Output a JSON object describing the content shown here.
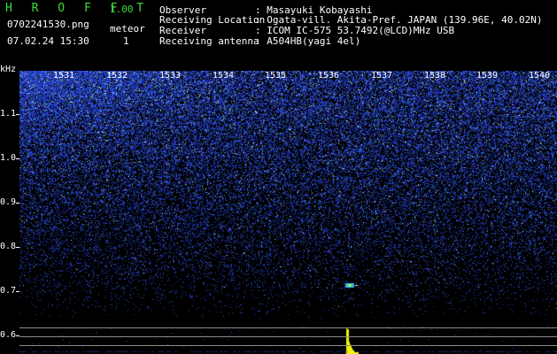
{
  "app": {
    "logo": "H R O F F T",
    "version": "1.00"
  },
  "file": {
    "name": "0702241530.png",
    "datetime": "07.02.24 15:30"
  },
  "meteor": {
    "label": "meteor",
    "count": "1"
  },
  "info": [
    {
      "label": "Observer",
      "value": ": Masayuki Kobayashi"
    },
    {
      "label": "Receiving Location",
      "value": ": Ogata-vill. Akita-Pref. JAPAN (139.96E, 40.02N)"
    },
    {
      "label": "Receiver",
      "value": ": ICOM IC-575 53.7492(@LCD)MHz USB"
    },
    {
      "label": "Receiving antenna",
      "value": ": A504HB(yagi 4el)"
    }
  ],
  "axis": {
    "y_unit": "kHz",
    "y_ticks": [
      "1.1",
      "1.0",
      "0.9",
      "0.8",
      "0.7",
      "0.6"
    ],
    "time_ticks": [
      "1531",
      "1532",
      "1533",
      "1534",
      "1535",
      "1536",
      "1537",
      "1538",
      "1539",
      "1540"
    ]
  },
  "colors": {
    "header_text": "#3ddc3d",
    "noise": "#2b3fd8",
    "signal": "#f2f200",
    "echo": "#40c0ff"
  }
}
